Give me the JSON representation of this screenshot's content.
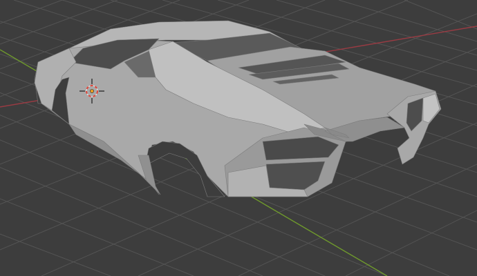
{
  "viewport": {
    "background_color": "#3d3d3d",
    "grid_color": "#545454",
    "x_axis_color": "#9a3b43",
    "y_axis_color": "#6f9a2c",
    "mesh_light_color": "#b9b9b9",
    "mesh_mid_color": "#9e9e9e",
    "mesh_dark_color": "#4a4a4a",
    "mesh_edge_color": "#7c7c7c",
    "cursor_red": "#e0463a",
    "cursor_white": "#f0f0f0",
    "origin_color": "#f0a020"
  },
  "icons": {
    "cursor": "3d-cursor-icon",
    "origin": "object-origin-icon"
  }
}
